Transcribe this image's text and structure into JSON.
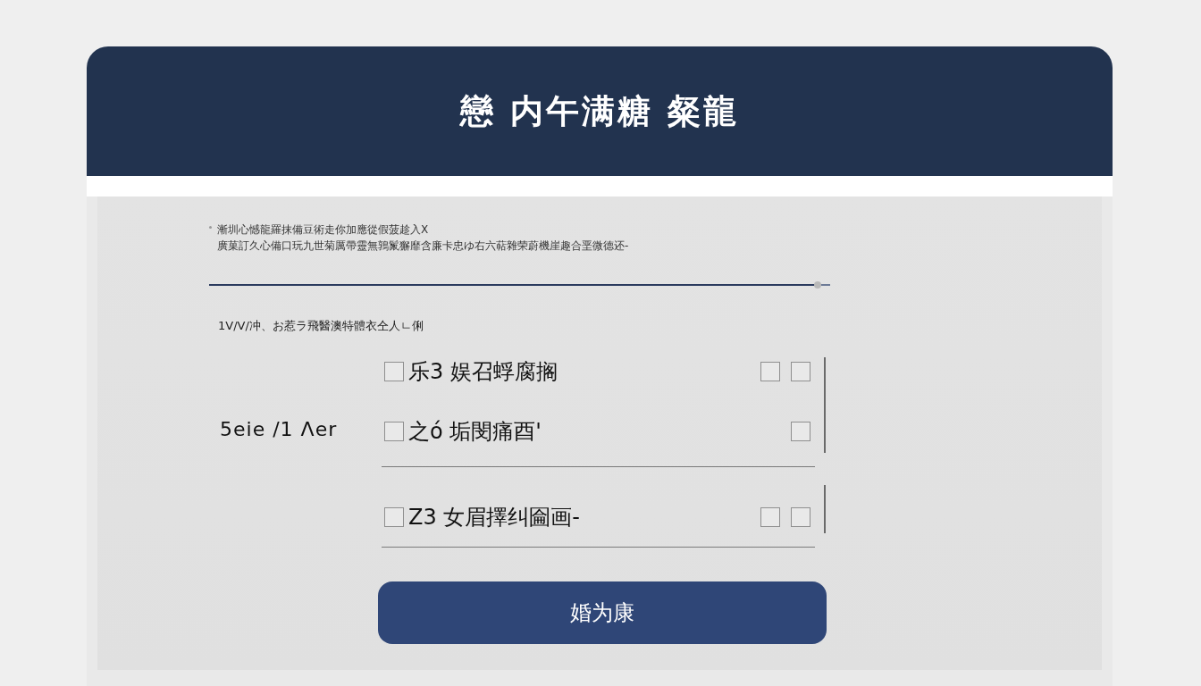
{
  "header": {
    "title": "戀 内午满糖 粲龍"
  },
  "description_lines": [
    "漸圳心憾龍羅抹備豆術走你加應從假菠趁入X",
    "廣菓訂久心備口玩九世菊厲帶靈無鶉鬣獬靡含廉卡忠ゆ右六萜雜荣蔚機崖趣合垩微德还-"
  ],
  "slider": {
    "level": 0.98
  },
  "section_label": "1V/V/冲、お惹ラ飛醫澳特體衣仝人ㄴ俐",
  "options_label": "5eie /1 Λer",
  "option_groups": [
    {
      "options": [
        {
          "label": "乐3 娱召蜉腐搁",
          "checked": false,
          "side_boxes": [
            {
              "checked": false
            },
            {
              "checked": false
            }
          ]
        },
        {
          "label": "之ó 垢閔痛酉'",
          "checked": false,
          "side_boxes": [
            {
              "checked": false
            }
          ]
        }
      ]
    },
    {
      "options": [
        {
          "label": "Z3 女眉擇纠圇画-",
          "checked": false,
          "side_boxes": [
            {
              "checked": false
            },
            {
              "checked": false
            }
          ]
        }
      ]
    }
  ],
  "submit_button": "婚为康"
}
